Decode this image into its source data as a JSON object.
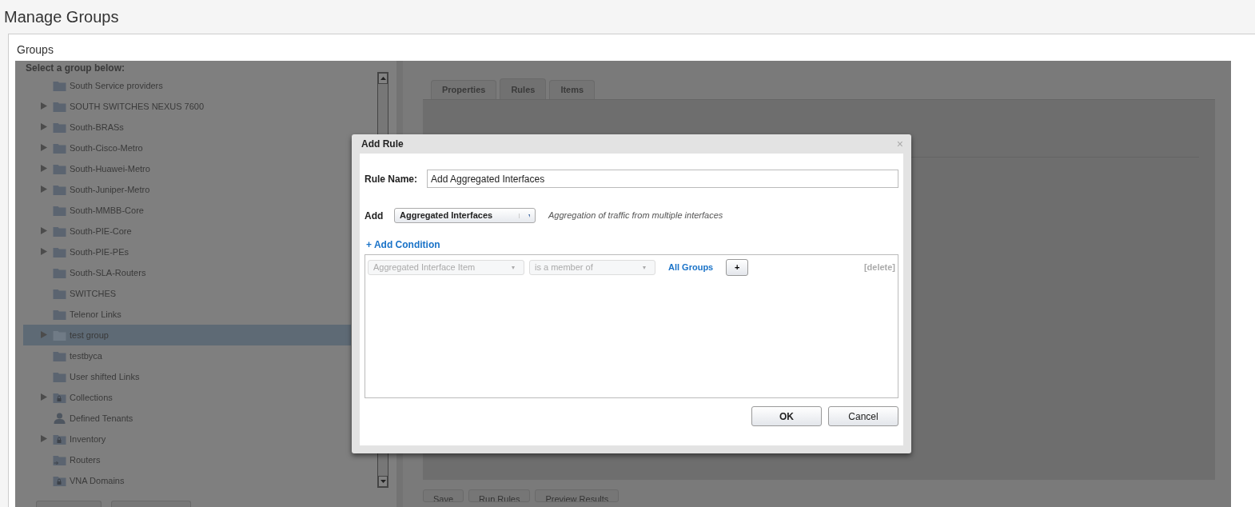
{
  "page": {
    "title": "Manage Groups"
  },
  "panel": {
    "title": "Groups"
  },
  "tree": {
    "heading": "Select a group below:",
    "items": [
      {
        "label": "South Service providers",
        "kind": "folder",
        "expandable": false,
        "selected": false
      },
      {
        "label": "SOUTH SWITCHES NEXUS 7600",
        "kind": "folder",
        "expandable": true,
        "selected": false
      },
      {
        "label": "South-BRASs",
        "kind": "folder",
        "expandable": true,
        "selected": false
      },
      {
        "label": "South-Cisco-Metro",
        "kind": "folder",
        "expandable": true,
        "selected": false
      },
      {
        "label": "South-Huawei-Metro",
        "kind": "folder",
        "expandable": true,
        "selected": false
      },
      {
        "label": "South-Juniper-Metro",
        "kind": "folder",
        "expandable": true,
        "selected": false
      },
      {
        "label": "South-MMBB-Core",
        "kind": "folder",
        "expandable": false,
        "selected": false
      },
      {
        "label": "South-PIE-Core",
        "kind": "folder",
        "expandable": true,
        "selected": false
      },
      {
        "label": "South-PIE-PEs",
        "kind": "folder",
        "expandable": true,
        "selected": false
      },
      {
        "label": "South-SLA-Routers",
        "kind": "folder",
        "expandable": false,
        "selected": false
      },
      {
        "label": "SWITCHES",
        "kind": "folder",
        "expandable": false,
        "selected": false
      },
      {
        "label": "Telenor Links",
        "kind": "folder",
        "expandable": false,
        "selected": false
      },
      {
        "label": "test group",
        "kind": "folder",
        "expandable": true,
        "selected": true
      },
      {
        "label": "testbyca",
        "kind": "folder",
        "expandable": false,
        "selected": false
      },
      {
        "label": "User shifted Links",
        "kind": "folder",
        "expandable": false,
        "selected": false
      },
      {
        "label": "Collections",
        "kind": "locked-folder",
        "expandable": true,
        "selected": false
      },
      {
        "label": "Defined Tenants",
        "kind": "person",
        "expandable": false,
        "selected": false
      },
      {
        "label": "Inventory",
        "kind": "locked-folder",
        "expandable": true,
        "selected": false
      },
      {
        "label": "Routers",
        "kind": "link-folder",
        "expandable": false,
        "selected": false
      },
      {
        "label": "VNA Domains",
        "kind": "locked-folder",
        "expandable": false,
        "selected": false
      }
    ]
  },
  "tabs": [
    {
      "label": "Properties",
      "selected": false
    },
    {
      "label": "Rules",
      "selected": true
    },
    {
      "label": "Items",
      "selected": false
    }
  ],
  "bottom_buttons": [
    "Save",
    "Run Rules",
    "Preview Results"
  ],
  "dialog": {
    "title": "Add Rule",
    "close": "×",
    "rule_name_label": "Rule Name:",
    "rule_name_value": "Add Aggregated Interfaces",
    "add_label": "Add",
    "add_select": "Aggregated Interfaces",
    "add_description": "Aggregation of traffic from multiple interfaces",
    "add_condition_link": "+ Add Condition",
    "conditions": [
      {
        "item": "Aggregated Interface Item",
        "operator": "is a member of",
        "target": "All Groups",
        "add": "+",
        "delete": "[delete]",
        "disabled": true
      }
    ],
    "buttons": [
      "OK",
      "Cancel"
    ]
  }
}
